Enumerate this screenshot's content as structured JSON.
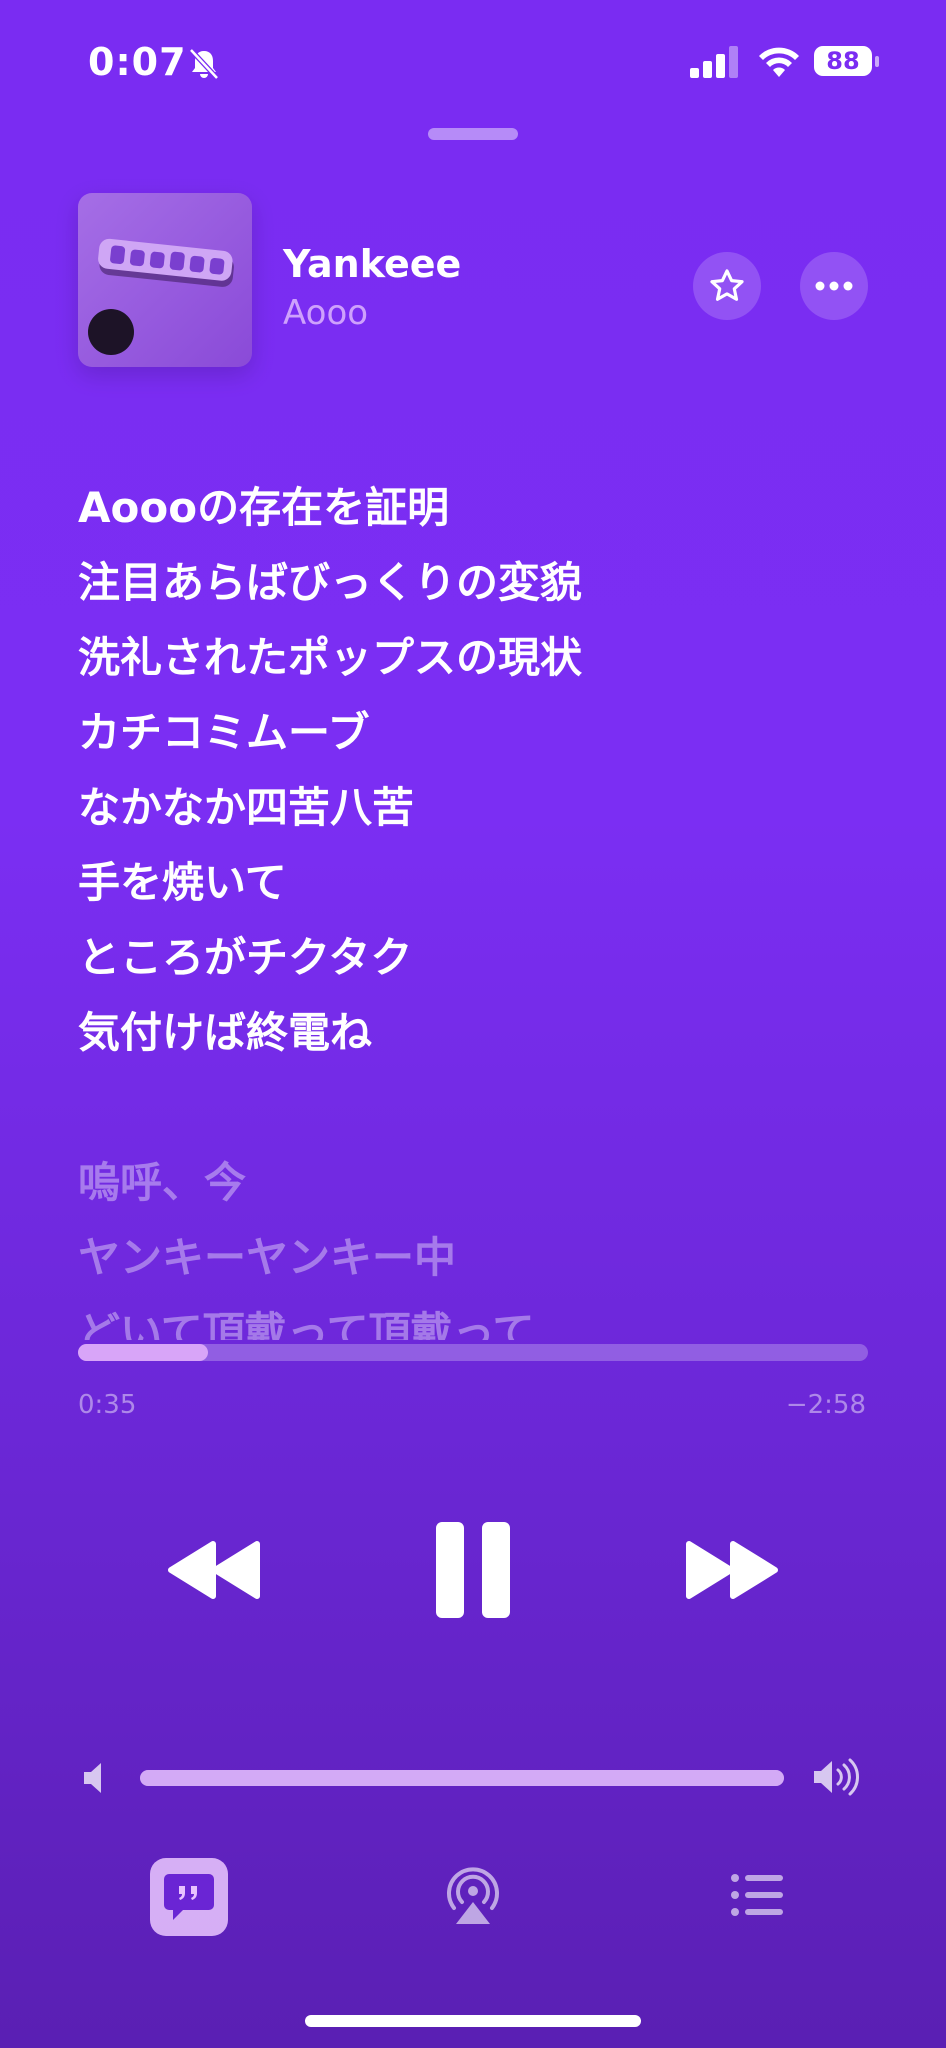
{
  "status_bar": {
    "time": "0:07",
    "battery": "88"
  },
  "now_playing": {
    "title": "Yankeee",
    "artist": "Aooo"
  },
  "lyrics": {
    "active": [
      "Aoooの存在を証明",
      "注目あらばびっくりの変貌",
      "洗礼されたポップスの現状",
      "カチコミムーブ",
      "なかなか四苦八苦",
      "手を焼いて",
      "ところがチクタク",
      "気付けば終電ね"
    ],
    "upcoming": [
      "嗚呼、今",
      "ヤンキーヤンキー中",
      "どいて頂戴って頂戴って"
    ]
  },
  "playback": {
    "elapsed": "0:35",
    "remaining": "−2:58",
    "progress_fraction": 0.165
  },
  "volume": {
    "level_fraction": 1.0
  },
  "colors": {
    "background": "#7a2cf2",
    "accent": "#e8c2ff"
  },
  "icons": [
    "bell-slash-icon",
    "cellular-signal-icon",
    "wifi-icon",
    "battery-icon",
    "star-icon",
    "ellipsis-icon",
    "rewind-icon",
    "pause-icon",
    "fast-forward-icon",
    "speaker-low-icon",
    "speaker-high-icon",
    "lyrics-icon",
    "airplay-icon",
    "queue-list-icon"
  ]
}
